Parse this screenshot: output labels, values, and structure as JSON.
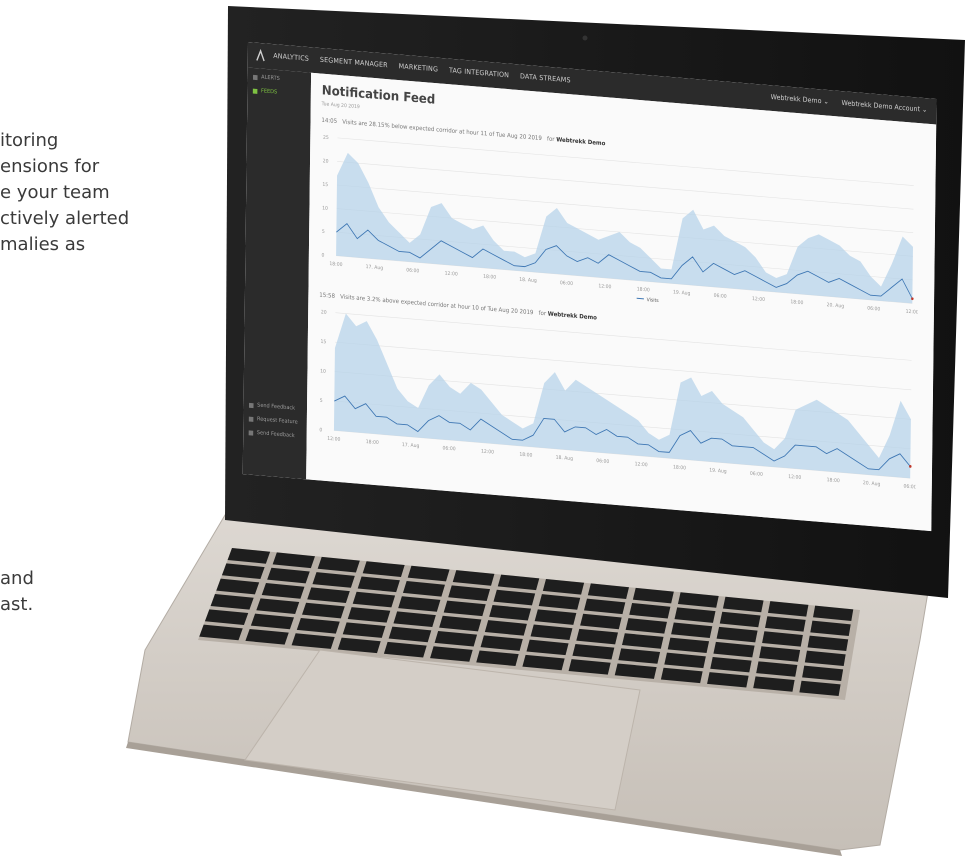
{
  "background_text": {
    "top_lines": [
      "itoring",
      "ensions for",
      "e your team",
      "ctively alerted",
      "malies as"
    ],
    "bottom_lines": [
      "and",
      "ast."
    ]
  },
  "app": {
    "nav": [
      "ANALYTICS",
      "SEGMENT MANAGER",
      "MARKETING",
      "TAG INTEGRATION",
      "DATA STREAMS"
    ],
    "account": [
      "Webtrekk Demo ⌄",
      "Webtrekk Demo Account ⌄"
    ],
    "sidebar_top": [
      "ALERTS",
      "FEEDS"
    ],
    "sidebar_bottom": [
      "Send Feedback",
      "Request Feature",
      "Send Feedback"
    ],
    "title": "Notification Feed",
    "date": "Tue Aug 20 2019"
  },
  "alerts": [
    {
      "time": "14:05",
      "text": "Visits are 28.15% below expected corridor at hour 11 of Tue Aug 20 2019",
      "for": "for",
      "account": "Webtrekk Demo"
    },
    {
      "time": "15:58",
      "text": "Visits are 3.2% above expected corridor at hour 10 of Tue Aug 20 2019",
      "for": "for",
      "account": "Webtrekk Demo"
    }
  ],
  "chart_data": [
    {
      "type": "area",
      "yticks": [
        "25",
        "20",
        "15",
        "10",
        "5",
        "0"
      ],
      "xticks": [
        "18:00",
        "17. Aug",
        "06:00",
        "12:00",
        "18:00",
        "18. Aug",
        "06:00",
        "12:00",
        "18:00",
        "19. Aug",
        "06:00",
        "12:00",
        "18:00",
        "20. Aug",
        "06:00",
        "12:00"
      ],
      "legend": "Visits",
      "ylim": [
        0,
        25
      ],
      "series_band_upper": [
        17,
        22,
        20,
        16,
        11,
        8,
        6,
        4,
        6,
        12,
        13,
        10,
        9,
        8,
        9,
        6,
        4,
        4,
        3,
        4,
        12,
        14,
        11,
        10,
        9,
        8,
        9,
        10,
        8,
        7,
        5,
        3,
        3,
        14,
        16,
        12,
        13,
        11,
        10,
        9,
        7,
        4,
        3,
        4,
        10,
        12,
        13,
        12,
        11,
        9,
        8,
        5,
        3,
        8,
        14,
        12
      ],
      "series_band_lower": [
        0,
        0,
        0,
        0,
        0,
        0,
        0,
        0,
        0,
        0,
        0,
        0,
        0,
        0,
        0,
        0,
        0,
        0,
        0,
        0,
        0,
        0,
        0,
        0,
        0,
        0,
        0,
        0,
        0,
        0,
        0,
        0,
        0,
        0,
        0,
        0,
        0,
        0,
        0,
        0,
        0,
        0,
        0,
        0,
        0,
        0,
        0,
        0,
        0,
        0,
        0,
        0,
        0,
        0,
        0,
        0
      ],
      "series_line": [
        5,
        7,
        4,
        6,
        4,
        3,
        2,
        2,
        1,
        3,
        5,
        4,
        3,
        2,
        4,
        3,
        2,
        1,
        1,
        2,
        5,
        6,
        4,
        3,
        4,
        3,
        5,
        4,
        3,
        2,
        2,
        1,
        1,
        4,
        6,
        3,
        5,
        4,
        3,
        4,
        3,
        2,
        1,
        2,
        4,
        5,
        4,
        3,
        4,
        3,
        2,
        1,
        1,
        3,
        5,
        1
      ]
    },
    {
      "type": "area",
      "yticks": [
        "20",
        "15",
        "10",
        "5",
        "0"
      ],
      "xticks": [
        "12:00",
        "18:00",
        "17. Aug",
        "06:00",
        "12:00",
        "18:00",
        "18. Aug",
        "06:00",
        "12:00",
        "18:00",
        "19. Aug",
        "06:00",
        "12:00",
        "18:00",
        "20. Aug",
        "06:00"
      ],
      "ylim": [
        0,
        20
      ],
      "series_band_upper": [
        14,
        20,
        18,
        19,
        16,
        12,
        8,
        6,
        5,
        9,
        11,
        9,
        8,
        10,
        9,
        7,
        5,
        4,
        3,
        4,
        11,
        13,
        10,
        12,
        11,
        10,
        9,
        8,
        7,
        6,
        4,
        3,
        4,
        13,
        14,
        11,
        12,
        10,
        9,
        8,
        6,
        4,
        3,
        5,
        10,
        11,
        12,
        11,
        10,
        9,
        7,
        5,
        3,
        7,
        13,
        10
      ],
      "series_band_lower": [
        0,
        0,
        0,
        0,
        0,
        0,
        0,
        0,
        0,
        0,
        0,
        0,
        0,
        0,
        0,
        0,
        0,
        0,
        0,
        0,
        0,
        0,
        0,
        0,
        0,
        0,
        0,
        0,
        0,
        0,
        0,
        0,
        0,
        0,
        0,
        0,
        0,
        0,
        0,
        0,
        0,
        0,
        0,
        0,
        0,
        0,
        0,
        0,
        0,
        0,
        0,
        0,
        0,
        0,
        0,
        0
      ],
      "series_line": [
        5,
        6,
        4,
        5,
        3,
        3,
        2,
        2,
        1,
        3,
        4,
        3,
        3,
        2,
        4,
        3,
        2,
        1,
        1,
        2,
        5,
        5,
        3,
        4,
        4,
        3,
        4,
        3,
        3,
        2,
        2,
        1,
        1,
        4,
        5,
        3,
        4,
        4,
        3,
        3,
        3,
        2,
        1,
        2,
        4,
        4,
        4,
        3,
        4,
        3,
        2,
        1,
        1,
        3,
        4,
        2
      ]
    }
  ],
  "colors": {
    "band": "#b7d3ea",
    "line": "#3d76b3",
    "frame": "#1c1c1c",
    "aluminium": "#cfc9c2"
  }
}
